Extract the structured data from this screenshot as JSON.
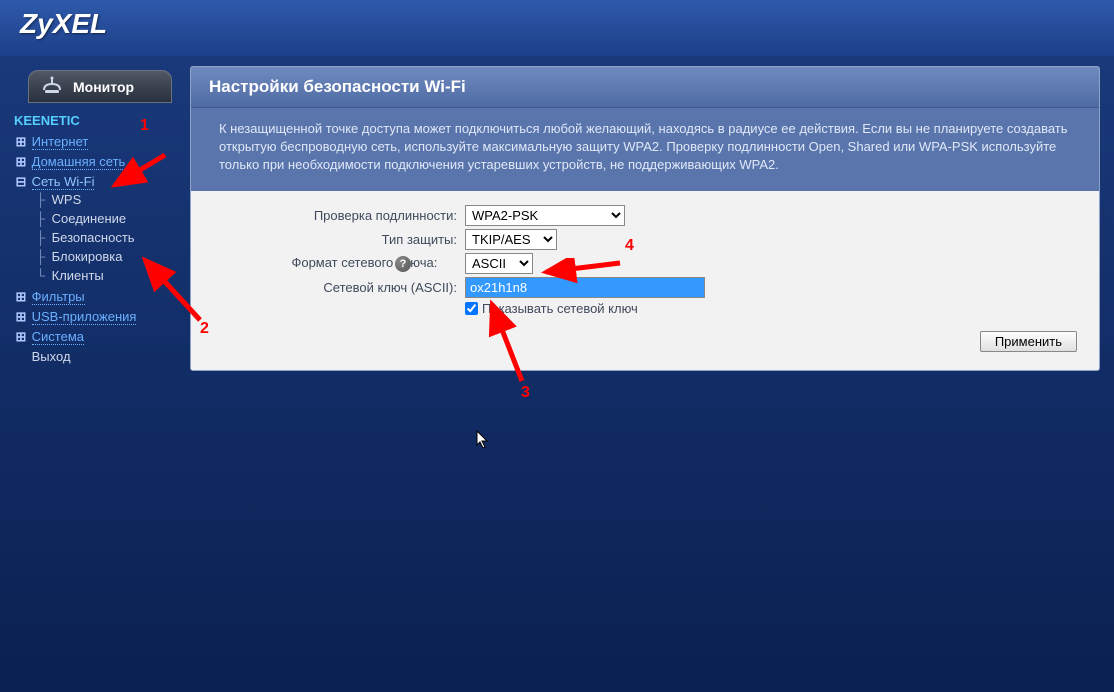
{
  "brand": "ZyXEL",
  "sidebar": {
    "monitor_label": "Монитор",
    "device_name": "KEENETIC",
    "items": [
      {
        "label": "Интернет",
        "expandable": true,
        "open": false
      },
      {
        "label": "Домашняя сеть",
        "expandable": true,
        "open": false
      },
      {
        "label": "Сеть Wi-Fi",
        "expandable": true,
        "open": true,
        "children": [
          {
            "label": "WPS"
          },
          {
            "label": "Соединение"
          },
          {
            "label": "Безопасность"
          },
          {
            "label": "Блокировка"
          },
          {
            "label": "Клиенты"
          }
        ]
      },
      {
        "label": "Фильтры",
        "expandable": true,
        "open": false
      },
      {
        "label": "USB-приложения",
        "expandable": true,
        "open": false
      },
      {
        "label": "Система",
        "expandable": true,
        "open": false
      },
      {
        "label": "Выход",
        "expandable": false,
        "open": false
      }
    ]
  },
  "panel": {
    "title": "Настройки безопасности Wi-Fi",
    "description": "К незащищенной точке доступа может подключиться любой желающий, находясь в радиусе ее действия. Если вы не планируете создавать открытую беспроводную сеть, используйте максимальную защиту WPA2. Проверку подлинности Open, Shared или WPA-PSK используйте только при необходимости подключения устаревших устройств, не поддерживающих WPA2.",
    "fields": {
      "auth_label": "Проверка подлинности:",
      "auth_value": "WPA2-PSK",
      "protection_label": "Тип защиты:",
      "protection_value": "TKIP/AES",
      "key_format_label": "Формат сетевого ключа:",
      "key_format_value": "ASCII",
      "key_label": "Сетевой ключ (ASCII):",
      "key_value": "ox21h1n8",
      "show_key_label": "Показывать сетевой ключ",
      "show_key_checked": true
    },
    "apply_label": "Применить"
  },
  "annotations": {
    "n1": "1",
    "n2": "2",
    "n3": "3",
    "n4": "4"
  }
}
